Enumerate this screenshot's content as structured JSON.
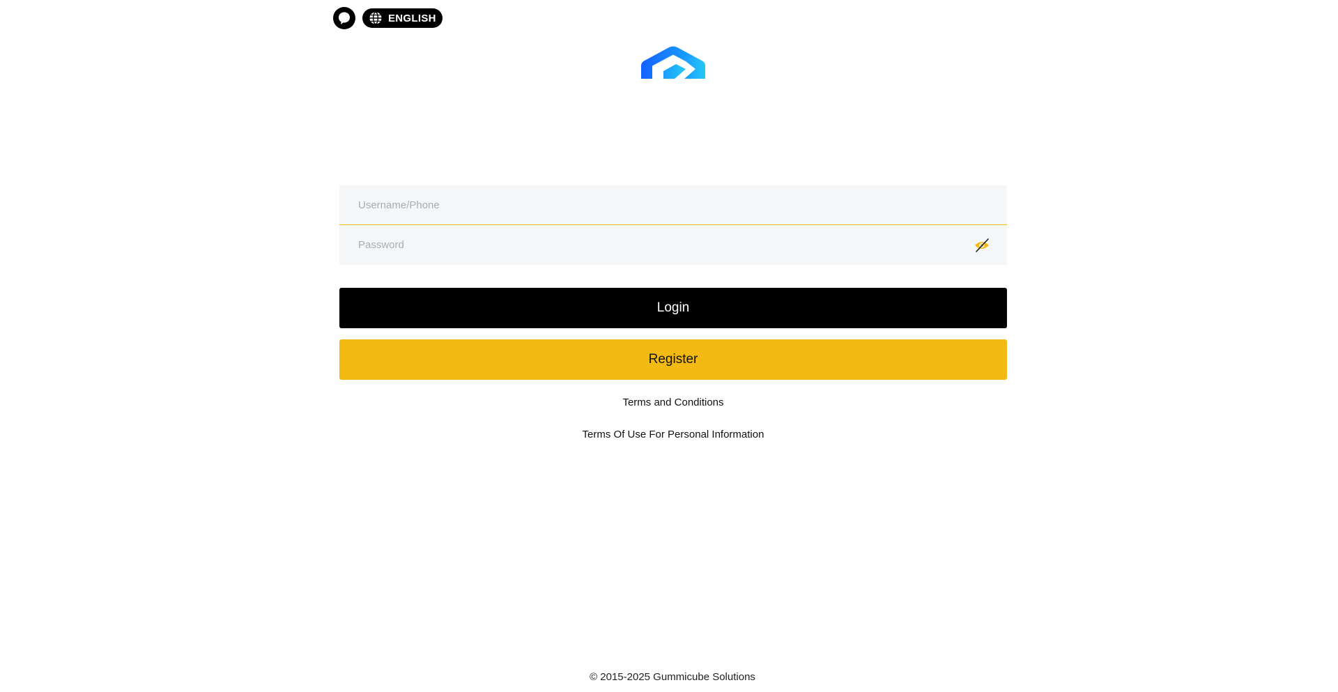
{
  "header": {
    "support_icon": "headset-chat-icon",
    "language_icon": "globe-icon",
    "language_label": "ENGLISH"
  },
  "logo": {
    "icon": "brand-logo-icon",
    "colors": [
      "#1565ff",
      "#1aa8ff",
      "#22c7f5"
    ]
  },
  "form": {
    "username": {
      "placeholder": "Username/Phone",
      "value": ""
    },
    "password": {
      "placeholder": "Password",
      "value": "",
      "toggle_icon": "eye-off-icon"
    }
  },
  "buttons": {
    "login_label": "Login",
    "register_label": "Register"
  },
  "links": {
    "terms": "Terms and Conditions",
    "privacy": "Terms Of Use For Personal Information"
  },
  "footer": {
    "copyright": "© 2015-2025 Gummicube Solutions"
  },
  "colors": {
    "accent": "#f2ba12",
    "primary_button": "#000000",
    "input_bg": "#f5f6f7"
  }
}
